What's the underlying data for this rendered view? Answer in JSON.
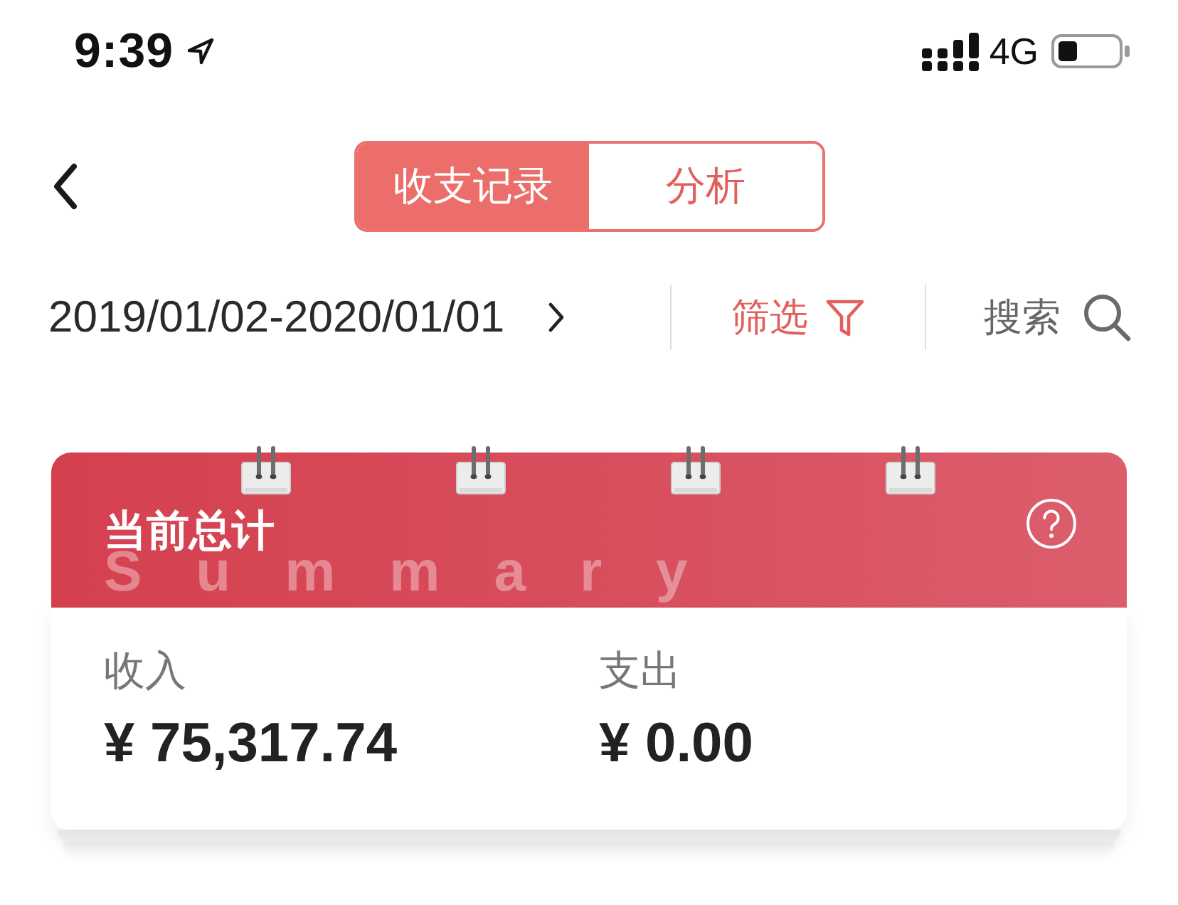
{
  "status_bar": {
    "time": "9:39",
    "network": "4G"
  },
  "header": {
    "segments": [
      {
        "label": "收支记录",
        "selected": true
      },
      {
        "label": "分析",
        "selected": false
      }
    ]
  },
  "filter_bar": {
    "date_range": "2019/01/02-2020/01/01",
    "filter_label": "筛选",
    "search_label": "搜索"
  },
  "summary_card": {
    "title": "当前总计",
    "background_text": "Summary",
    "totals": [
      {
        "label": "收入",
        "amount": "¥ 75,317.74"
      },
      {
        "label": "支出",
        "amount": "¥ 0.00"
      }
    ]
  }
}
